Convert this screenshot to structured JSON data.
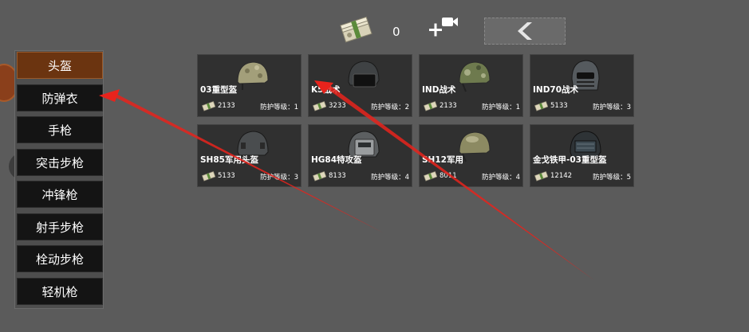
{
  "topbar": {
    "cash_count": "0",
    "icons": [
      "cash-stack-icon",
      "add-video-icon",
      "back-arrow-icon"
    ]
  },
  "menu": {
    "items": [
      {
        "label": "头盔",
        "active": true
      },
      {
        "label": "防弹衣",
        "active": false
      },
      {
        "label": "手枪",
        "active": false
      },
      {
        "label": "突击步枪",
        "active": false
      },
      {
        "label": "冲锋枪",
        "active": false
      },
      {
        "label": "射手步枪",
        "active": false
      },
      {
        "label": "栓动步枪",
        "active": false
      },
      {
        "label": "轻机枪",
        "active": false
      }
    ]
  },
  "items": [
    {
      "name": "03重型盔",
      "price": "2133",
      "level": "防护等级：1"
    },
    {
      "name": "K5战术",
      "price": "3233",
      "level": "防护等级：2"
    },
    {
      "name": "IND战术",
      "price": "2133",
      "level": "防护等级：1"
    },
    {
      "name": "IND70战术",
      "price": "5133",
      "level": "防护等级：3"
    },
    {
      "name": "SH85军用头盔",
      "price": "5133",
      "level": "防护等级：3"
    },
    {
      "name": "HG84特攻盔",
      "price": "8133",
      "level": "防护等级：4"
    },
    {
      "name": "SH12军用",
      "price": "8011",
      "level": "防护等级：4"
    },
    {
      "name": "金戈铁甲-03重型盔",
      "price": "12142",
      "level": "防护等级：5"
    }
  ],
  "colors": {
    "background": "#5b5b5b",
    "active_tab": "#6b3410",
    "card": "#303030",
    "annotation_arrow": "#e8231c"
  }
}
